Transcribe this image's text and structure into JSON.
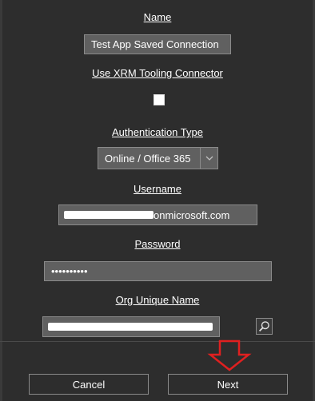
{
  "form": {
    "name_label": "Name",
    "name_value": "Test App Saved Connection",
    "xrm_label": "Use XRM Tooling Connector",
    "xrm_checked": false,
    "auth_label": "Authentication Type",
    "auth_value": "Online / Office 365",
    "username_label": "Username",
    "username_suffix": "onmicrosoft.com",
    "password_label": "Password",
    "password_value": "••••••••••",
    "org_label": "Org Unique Name"
  },
  "footer": {
    "cancel_label": "Cancel",
    "next_label": "Next"
  },
  "colors": {
    "background": "#2d2d2d",
    "field": "#606060",
    "annotation_arrow": "#e02020"
  },
  "icons": {
    "search": "magnifier-icon",
    "dropdown": "chevron-down-icon",
    "annotation": "down-arrow-icon"
  }
}
